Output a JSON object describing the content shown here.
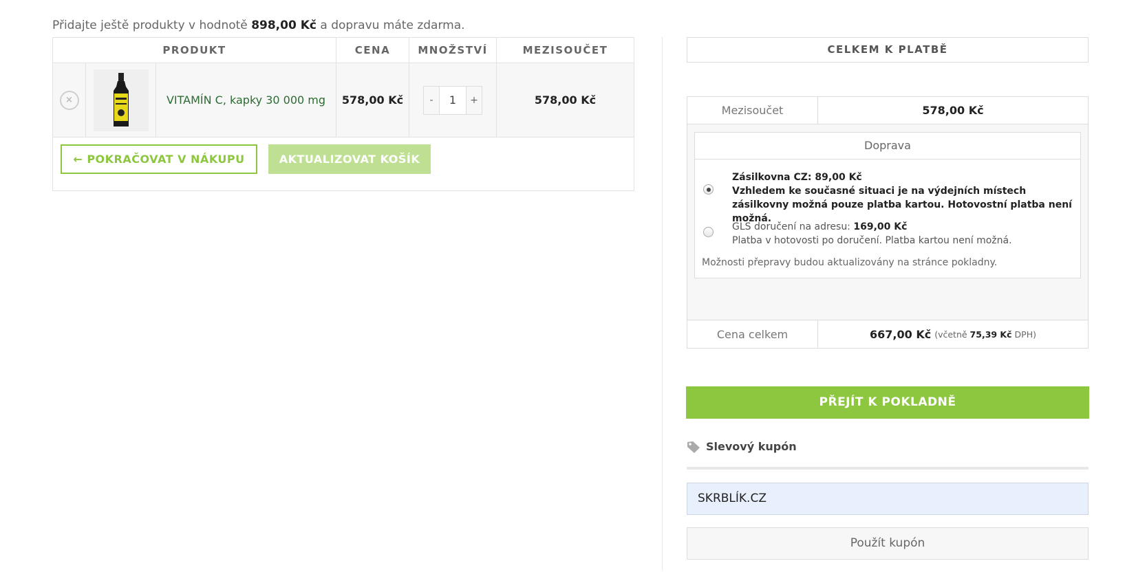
{
  "notice": {
    "before": "Přidajte ještě produkty v hodnotě",
    "amount": "898,00 Kč",
    "after": "a dopravu máte zdarma."
  },
  "cart": {
    "headers": {
      "product": "PRODUKT",
      "price": "CENA",
      "quantity": "MNOŽSTVÍ",
      "subtotal": "MEZISOUČET"
    },
    "items": [
      {
        "name": "VITAMÍN C, kapky 30 000 mg",
        "price": "578,00 Kč",
        "quantity": "1",
        "subtotal": "578,00 Kč"
      }
    ],
    "qty_minus": "-",
    "qty_plus": "+",
    "remove_icon": "×",
    "continue_label": "← POKRAČOVAT V NÁKUPU",
    "update_label": "AKTUALIZOVAT KOŠÍK"
  },
  "totals": {
    "title": "CELKEM K PLATBĚ",
    "subtotal_label": "Mezisoučet",
    "subtotal_value": "578,00 Kč",
    "shipping_title": "Doprava",
    "shipping_options": [
      {
        "label": "Zásilkovna CZ:",
        "amount": "89,00 Kč",
        "note": "Vzhledem ke současné situaci je na výdejních místech zásilkovny možná pouze platba kartou. Hotovostní platba není možná.",
        "selected": true
      },
      {
        "label": "GLS doručení na adresu:",
        "amount": "169,00 Kč",
        "note": "Platba v hotovosti po doručení. Platba kartou není možná.",
        "selected": false
      }
    ],
    "shipping_note": "Možnosti přepravy budou aktualizovány na stránce pokladny.",
    "total_label": "Cena celkem",
    "total_value": "667,00 Kč",
    "tax_prefix": "(včetně",
    "tax_value": "75,39 Kč",
    "tax_suffix": "DPH)"
  },
  "checkout_label": "PŘEJÍT K POKLADNĚ",
  "coupon": {
    "icon": "tag-icon",
    "title": "Slevový kupón",
    "value": "SKRBLÍK.CZ",
    "apply_label": "Použít kupón"
  },
  "colors": {
    "accent": "#8dc63f",
    "accent_light": "#bfe093",
    "product_link": "#2d6b33"
  }
}
